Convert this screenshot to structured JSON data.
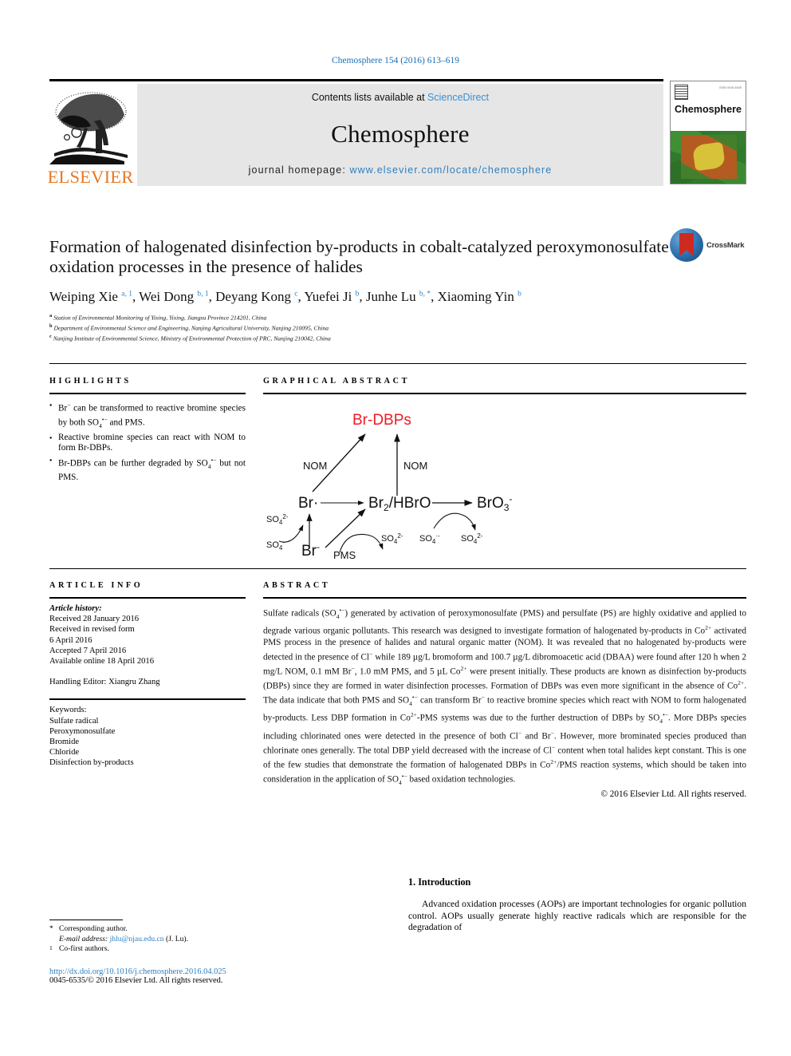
{
  "running_head": "Chemosphere 154 (2016) 613–619",
  "masthead": {
    "contents_prefix": "Contents lists available at ",
    "sciencedirect": "ScienceDirect",
    "journal_title": "Chemosphere",
    "homepage_prefix": "journal homepage: ",
    "homepage_url": "www.elsevier.com/locate/chemosphere",
    "publisher": "ELSEVIER",
    "cover_name": "Chemosphere"
  },
  "article": {
    "title": "Formation of halogenated disinfection by-products in cobalt-catalyzed peroxymonosulfate oxidation processes in the presence of halides",
    "crossmark_label": "CrossMark",
    "authors_html": "Weiping Xie <sup>a, 1</sup>, Wei Dong <sup>b, 1</sup>, Deyang Kong <sup>c</sup>, Yuefei Ji <sup>b</sup>, Junhe Lu <sup>b, *</sup>, Xiaoming Yin <sup>b</sup>",
    "affiliations": [
      {
        "mark": "a",
        "text": "Station of Environmental Monitoring of Yixing, Yixing, Jiangsu Province 214201, China"
      },
      {
        "mark": "b",
        "text": "Department of Environmental Science and Engineering, Nanjing Agricultural University, Nanjing 210095, China"
      },
      {
        "mark": "c",
        "text": "Nanjing Institute of Environmental Science, Ministry of Environmental Protection of PRC, Nanjing 210042, China"
      }
    ]
  },
  "highlights": {
    "heading": "HIGHLIGHTS",
    "items_html": [
      "Br<sup class=\"t\">−</sup> can be transformed to reactive bromine species by both SO<sub class=\"t\">4</sub><sup class=\"t\">•−</sup> and PMS.",
      "Reactive bromine species can react with NOM to form Br-DBPs.",
      "Br-DBPs can be further degraded by SO<sub class=\"t\">4</sub><sup class=\"t\">•−</sup> but not PMS."
    ]
  },
  "graphical_abstract": {
    "heading": "GRAPHICAL ABSTRACT",
    "accent_color": "#ee1c25",
    "labels": {
      "product": "Br-DBPs",
      "nom_left": "NOM",
      "nom_right": "NOM",
      "br_radical": "Br·",
      "br_anion_left": "Br⁻",
      "br2_hbro": "Br₂/HBrO",
      "bromate": "BrO₃⁻",
      "pms": "PMS",
      "so4_2minus_upper": "SO₄²⁻",
      "so4_radical_lower": "SO₄⁻",
      "so4_2minus_mid": "SO₄²⁻",
      "so4_radical_right": "SO₄·⁻",
      "so4_2minus_right": "SO₄²⁻"
    }
  },
  "article_info": {
    "heading": "ARTICLE INFO",
    "history_label": "Article history:",
    "history": [
      "Received 28 January 2016",
      "Received in revised form",
      "6 April 2016",
      "Accepted 7 April 2016",
      "Available online 18 April 2016"
    ],
    "handling_editor": "Handling Editor: Xiangru Zhang",
    "keywords_label": "Keywords:",
    "keywords": [
      "Sulfate radical",
      "Peroxymonosulfate",
      "Bromide",
      "Chloride",
      "Disinfection by-products"
    ]
  },
  "abstract": {
    "heading": "ABSTRACT",
    "body_html": "Sulfate radicals (SO<sub class=\"t\">4</sub><sup class=\"t\">•−</sup>) generated by activation of peroxymonosulfate (PMS) and persulfate (PS) are highly oxidative and applied to degrade various organic pollutants. This research was designed to investigate formation of halogenated by-products in Co<sup class=\"t\">2+</sup> activated PMS process in the presence of halides and natural organic matter (NOM). It was revealed that no halogenated by-products were detected in the presence of Cl<sup class=\"t\">−</sup> while 189 µg/L bromoform and 100.7 µg/L dibromoacetic acid (DBAA) were found after 120 h when 2 mg/L NOM, 0.1 mM Br<sup class=\"t\">−</sup>, 1.0 mM PMS, and 5 µL Co<sup class=\"t\">2+</sup> were present initially. These products are known as disinfection by-products (DBPs) since they are formed in water disinfection processes. Formation of DBPs was even more significant in the absence of Co<sup class=\"t\">2+</sup>. The data indicate that both PMS and SO<sub class=\"t\">4</sub><sup class=\"t\">•−</sup> can transform Br<sup class=\"t\">−</sup> to reactive bromine species which react with NOM to form halogenated by-products. Less DBP formation in Co<sup class=\"t\">2+</sup>-PMS systems was due to the further destruction of DBPs by SO<sub class=\"t\">4</sub><sup class=\"t\">•−</sup>. More DBPs species including chlorinated ones were detected in the presence of both Cl<sup class=\"t\">−</sup> and Br<sup class=\"t\">−</sup>. However, more brominated species produced than chlorinate ones generally. The total DBP yield decreased with the increase of Cl<sup class=\"t\">−</sup> content when total halides kept constant. This is one of the few studies that demonstrate the formation of halogenated DBPs in Co<sup class=\"t\">2+</sup>/PMS reaction systems, which should be taken into consideration in the application of SO<sub class=\"t\">4</sub><sup class=\"t\">•−</sup> based oxidation technologies.",
    "copyright": "© 2016 Elsevier Ltd. All rights reserved."
  },
  "introduction": {
    "heading": "1. Introduction",
    "paragraph": "Advanced oxidation processes (AOPs) are important technologies for organic pollution control. AOPs usually generate highly reactive radicals which are responsible for the degradation of"
  },
  "footnotes": {
    "corresponding_author": "Corresponding author.",
    "email_label": "E-mail address:",
    "email": "jhlu@njau.edu.cn",
    "email_owner": "(J. Lu).",
    "co_first": "Co-first authors.",
    "doi": "http://dx.doi.org/10.1016/j.chemosphere.2016.04.025",
    "issn_line": "0045-6535/© 2016 Elsevier Ltd. All rights reserved."
  }
}
